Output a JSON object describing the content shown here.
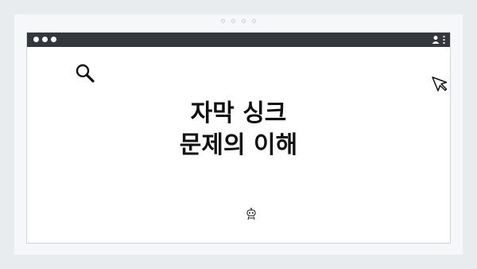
{
  "slide": {
    "title_line1": "자막 싱크",
    "title_line2": "문제의 이해"
  },
  "icons": {
    "search": "search-icon",
    "cursor": "cursor-icon",
    "user": "user-icon",
    "menu": "kebab-menu-icon",
    "robot": "robot-icon"
  },
  "colors": {
    "titlebar": "#34383c",
    "background": "#e9ecef",
    "text": "#111111"
  }
}
